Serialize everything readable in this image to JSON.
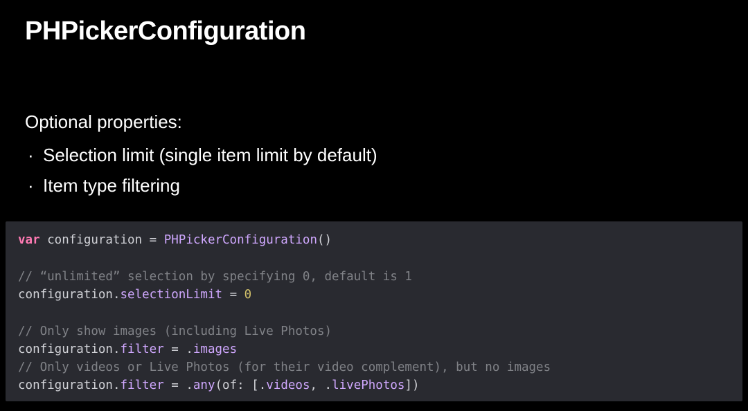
{
  "slide": {
    "title": "PHPickerConfiguration",
    "subhead": "Optional properties:",
    "bullets": [
      "Selection limit (single item limit by default)",
      "Item type filtering"
    ],
    "code": {
      "tokens": [
        {
          "cls": "tok-keyword",
          "text": "var"
        },
        {
          "cls": "tok-default",
          "text": " configuration = "
        },
        {
          "cls": "tok-type",
          "text": "PHPickerConfiguration"
        },
        {
          "cls": "tok-default",
          "text": "()\n\n"
        },
        {
          "cls": "tok-comment",
          "text": "// “unlimited” selection by specifying 0, default is 1"
        },
        {
          "cls": "tok-default",
          "text": "\nconfiguration."
        },
        {
          "cls": "tok-property",
          "text": "selectionLimit"
        },
        {
          "cls": "tok-default",
          "text": " = "
        },
        {
          "cls": "tok-number",
          "text": "0"
        },
        {
          "cls": "tok-default",
          "text": "\n\n"
        },
        {
          "cls": "tok-comment",
          "text": "// Only show images (including Live Photos)"
        },
        {
          "cls": "tok-default",
          "text": "\nconfiguration."
        },
        {
          "cls": "tok-property",
          "text": "filter"
        },
        {
          "cls": "tok-default",
          "text": " = ."
        },
        {
          "cls": "tok-member",
          "text": "images"
        },
        {
          "cls": "tok-default",
          "text": "\n"
        },
        {
          "cls": "tok-comment",
          "text": "// Only videos or Live Photos (for their video complement), but no images"
        },
        {
          "cls": "tok-default",
          "text": "\nconfiguration."
        },
        {
          "cls": "tok-property",
          "text": "filter"
        },
        {
          "cls": "tok-default",
          "text": " = ."
        },
        {
          "cls": "tok-member",
          "text": "any"
        },
        {
          "cls": "tok-default",
          "text": "(of: [."
        },
        {
          "cls": "tok-enum",
          "text": "videos"
        },
        {
          "cls": "tok-default",
          "text": ", ."
        },
        {
          "cls": "tok-enum",
          "text": "livePhotos"
        },
        {
          "cls": "tok-default",
          "text": "])"
        }
      ]
    }
  }
}
